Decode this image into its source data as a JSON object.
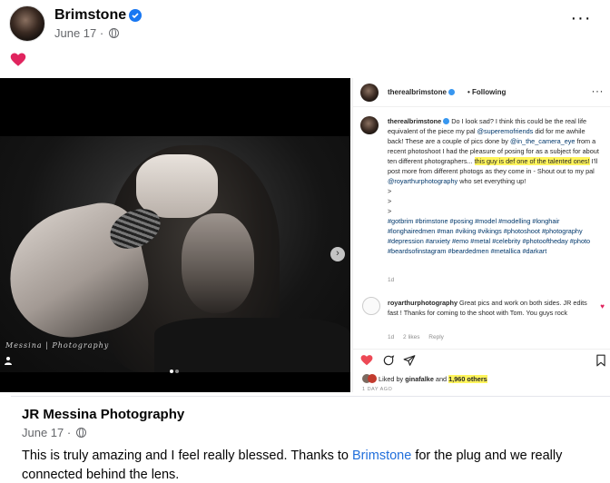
{
  "post": {
    "author": "Brimstone",
    "date": "June 17",
    "date_separator": "·",
    "reaction_emoji": "red-heart",
    "more_label": "···"
  },
  "media": {
    "watermark": "Messina | Photography",
    "carousel": {
      "count": 2,
      "active": 1
    },
    "next_label": "›"
  },
  "instagram": {
    "handle": "therealbrimstone",
    "following_label": "• Following",
    "more_label": "···",
    "caption": {
      "handle": "therealbrimstone",
      "text1": " Do I look sad? I think this could be the real life equivalent of the piece my pal ",
      "mention1": "@superemofriends",
      "text2": " did for me awhile back! These are a couple of pics done by ",
      "mention2": "@in_the_camera_eye",
      "text3": " from a recent photoshoot I had the pleasure of posing for as a subject for about ten different photographers... ",
      "highlight": "this guy is def one of the talented ones!",
      "text4": " I'll post more from different photogs as they come in - Shout out to my pal ",
      "mention3": "@royarthurphotography",
      "text5": " who set everything up!",
      "gt1": ">",
      "gt2": ">",
      "gt3": ">",
      "hashtags": "#gotbrim #brimstone #posing #model #modelling #longhair #longhairedmen #man #viking #vikings #photoshoot #photography #depression #anxiety #emo #metal #celebrity #photooftheday #photo #beardsofinstagram #beardedmen #metallica #darkart",
      "time": "1d"
    },
    "comment": {
      "handle": "royarthurphotography",
      "text": " Great pics and work on both sides. JR edits fast ! Thanks for coming to the shoot with Tom. You guys rock",
      "time": "1d",
      "likes": "2 likes",
      "reply": "Reply"
    },
    "likes": {
      "prefix": "Liked by ",
      "user": "ginafalke",
      "middle": " and ",
      "count": "1,960 others"
    },
    "post_date": "1 DAY AGO"
  },
  "reply_card": {
    "author": "JR Messina Photography",
    "date": "June 17",
    "date_separator": "·",
    "body_before": "This is truly amazing and I feel really blessed. Thanks to ",
    "link": "Brimstone",
    "body_after": " for the plug and we really connected behind the lens."
  },
  "colors": {
    "facebook_blue": "#1877f2",
    "link_blue": "#216fdb",
    "instagram_like": "#ed4956",
    "highlight": "#fff45c"
  }
}
